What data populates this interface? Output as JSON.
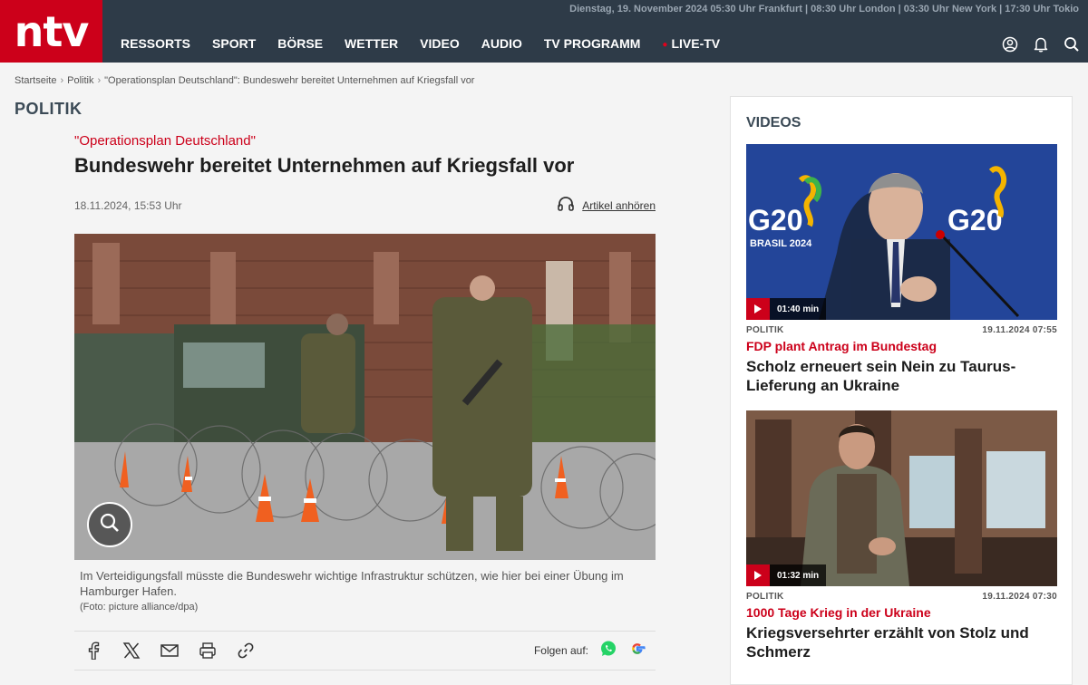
{
  "header": {
    "logo_text": "ntv",
    "datetime": "Dienstag, 19. November 2024 05:30 Uhr Frankfurt | 08:30 Uhr London | 03:30 Uhr New York | 17:30 Uhr Tokio",
    "nav": [
      "RESSORTS",
      "SPORT",
      "BÖRSE",
      "WETTER",
      "VIDEO",
      "AUDIO",
      "TV PROGRAMM"
    ],
    "live": "LIVE-TV",
    "icons": [
      "user-icon",
      "bell-icon",
      "search-icon"
    ]
  },
  "breadcrumb": [
    "Startseite",
    "Politik",
    "\"Operationsplan Deutschland\": Bundeswehr bereitet Unternehmen auf Kriegsfall vor"
  ],
  "section_title": "POLITIK",
  "article": {
    "kicker": "\"Operationsplan Deutschland\"",
    "headline": "Bundeswehr bereitet Unternehmen auf Kriegsfall vor",
    "date": "18.11.2024, 15:53 Uhr",
    "listen_label": "Artikel anhören",
    "caption": "Im Verteidigungsfall müsste die Bundeswehr wichtige Infrastruktur schützen, wie hier bei einer Übung im Hamburger Hafen.",
    "credit": "(Foto: picture alliance/dpa)",
    "share_icons": [
      "facebook-icon",
      "x-icon",
      "mail-icon",
      "print-icon",
      "link-icon"
    ],
    "follow_label": "Folgen auf:"
  },
  "sidebar": {
    "title": "VIDEOS",
    "videos": [
      {
        "duration": "01:40 min",
        "category": "POLITIK",
        "date": "19.11.2024 07:55",
        "kicker": "FDP plant Antrag im Bundestag",
        "title": "Scholz erneuert sein Nein zu Taurus-Lieferung an Ukraine",
        "banner_text": "G20",
        "banner_sub": "BRASIL 2024"
      },
      {
        "duration": "01:32 min",
        "category": "POLITIK",
        "date": "19.11.2024 07:30",
        "kicker": "1000 Tage Krieg in der Ukraine",
        "title": "Kriegsversehrter erzählt von Stolz und Schmerz"
      }
    ]
  },
  "colors": {
    "brand_red": "#cc001a",
    "header_bg": "#2e3b48"
  }
}
